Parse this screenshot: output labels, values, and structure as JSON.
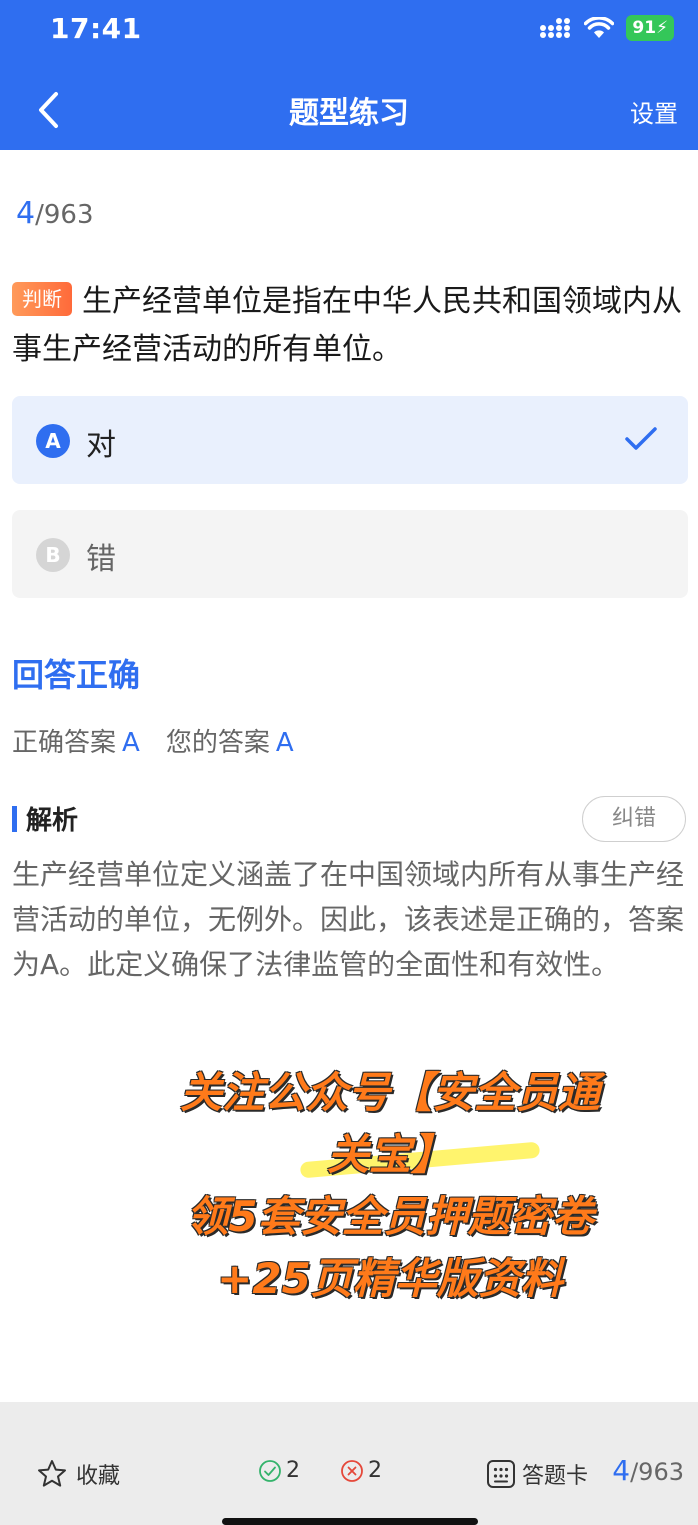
{
  "status_bar": {
    "time": "17:41",
    "battery": "91"
  },
  "nav": {
    "title": "题型练习",
    "settings": "设置"
  },
  "counter": {
    "current": "4",
    "total": "/963"
  },
  "question": {
    "type_badge": "判断",
    "text": "生产经营单位是指在中华人民共和国领域内从事生产经营活动的所有单位。"
  },
  "options": [
    {
      "letter": "A",
      "text": "对",
      "selected": true
    },
    {
      "letter": "B",
      "text": "错",
      "selected": false
    }
  ],
  "result": {
    "title": "回答正确",
    "correct_label": "正确答案",
    "correct_value": "A",
    "yours_label": "您的答案",
    "yours_value": "A"
  },
  "analysis": {
    "title": "解析",
    "report": "纠错",
    "body": "生产经营单位定义涵盖了在中国领域内所有从事生产经营活动的单位，无例外。因此，该表述是正确的，答案为A。此定义确保了法律监管的全面性和有效性。"
  },
  "promo": {
    "line1": "关注公众号【安全员通",
    "line2": "关宝】",
    "line3": "领5套安全员押题密卷",
    "line4": "+25页精华版资料"
  },
  "footer": {
    "favorite": "收藏",
    "right_count": "2",
    "wrong_count": "2",
    "answer_card": "答题卡",
    "current": "4",
    "total": "/963"
  },
  "colors": {
    "primary": "#2f6ef0",
    "correct": "#34b36b",
    "wrong": "#e5483a",
    "promo": "#ff7a1a"
  }
}
